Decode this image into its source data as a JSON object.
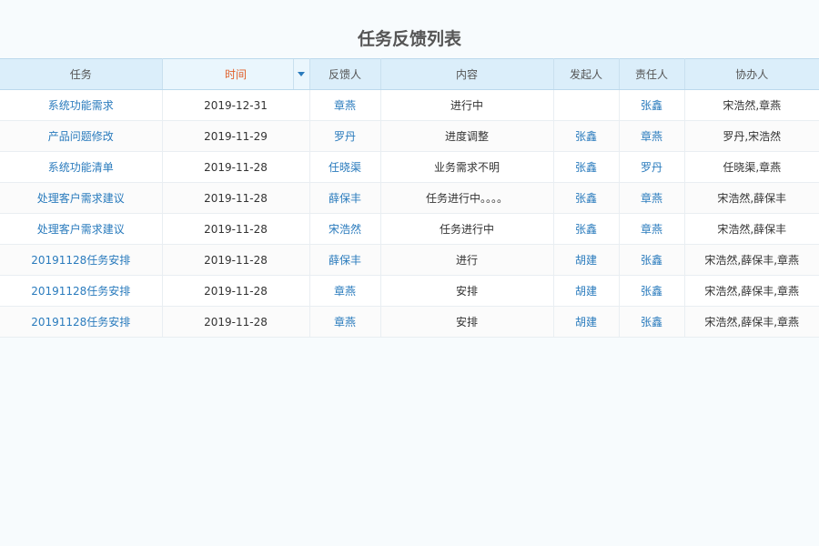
{
  "title": "任务反馈列表",
  "columns": [
    {
      "key": "task",
      "label": "任务"
    },
    {
      "key": "time",
      "label": "时间"
    },
    {
      "key": "feedback_by",
      "label": "反馈人"
    },
    {
      "key": "content",
      "label": "内容"
    },
    {
      "key": "initiator",
      "label": "发起人"
    },
    {
      "key": "owner",
      "label": "责任人"
    },
    {
      "key": "assistants",
      "label": "协办人"
    }
  ],
  "sorted_column": "time",
  "rows": [
    {
      "task": "系统功能需求",
      "time": "2019-12-31",
      "feedback_by": "章燕",
      "content": "进行中",
      "initiator": "",
      "owner": "张鑫",
      "assistants": "宋浩然,章燕"
    },
    {
      "task": "产品问题修改",
      "time": "2019-11-29",
      "feedback_by": "罗丹",
      "content": "进度调整",
      "initiator": "张鑫",
      "owner": "章燕",
      "assistants": "罗丹,宋浩然"
    },
    {
      "task": "系统功能清单",
      "time": "2019-11-28",
      "feedback_by": "任晓渠",
      "content": "业务需求不明",
      "initiator": "张鑫",
      "owner": "罗丹",
      "assistants": "任晓渠,章燕"
    },
    {
      "task": "处理客户需求建议",
      "time": "2019-11-28",
      "feedback_by": "薛保丰",
      "content": "任务进行中。。。。",
      "initiator": "张鑫",
      "owner": "章燕",
      "assistants": "宋浩然,薛保丰"
    },
    {
      "task": "处理客户需求建议",
      "time": "2019-11-28",
      "feedback_by": "宋浩然",
      "content": "任务进行中",
      "initiator": "张鑫",
      "owner": "章燕",
      "assistants": "宋浩然,薛保丰"
    },
    {
      "task": "20191128任务安排",
      "time": "2019-11-28",
      "feedback_by": "薛保丰",
      "content": "进行",
      "initiator": "胡建",
      "owner": "张鑫",
      "assistants": "宋浩然,薛保丰,章燕"
    },
    {
      "task": "20191128任务安排",
      "time": "2019-11-28",
      "feedback_by": "章燕",
      "content": "安排",
      "initiator": "胡建",
      "owner": "张鑫",
      "assistants": "宋浩然,薛保丰,章燕"
    },
    {
      "task": "20191128任务安排",
      "time": "2019-11-28",
      "feedback_by": "章燕",
      "content": "安排",
      "initiator": "胡建",
      "owner": "张鑫",
      "assistants": "宋浩然,薛保丰,章燕"
    }
  ]
}
